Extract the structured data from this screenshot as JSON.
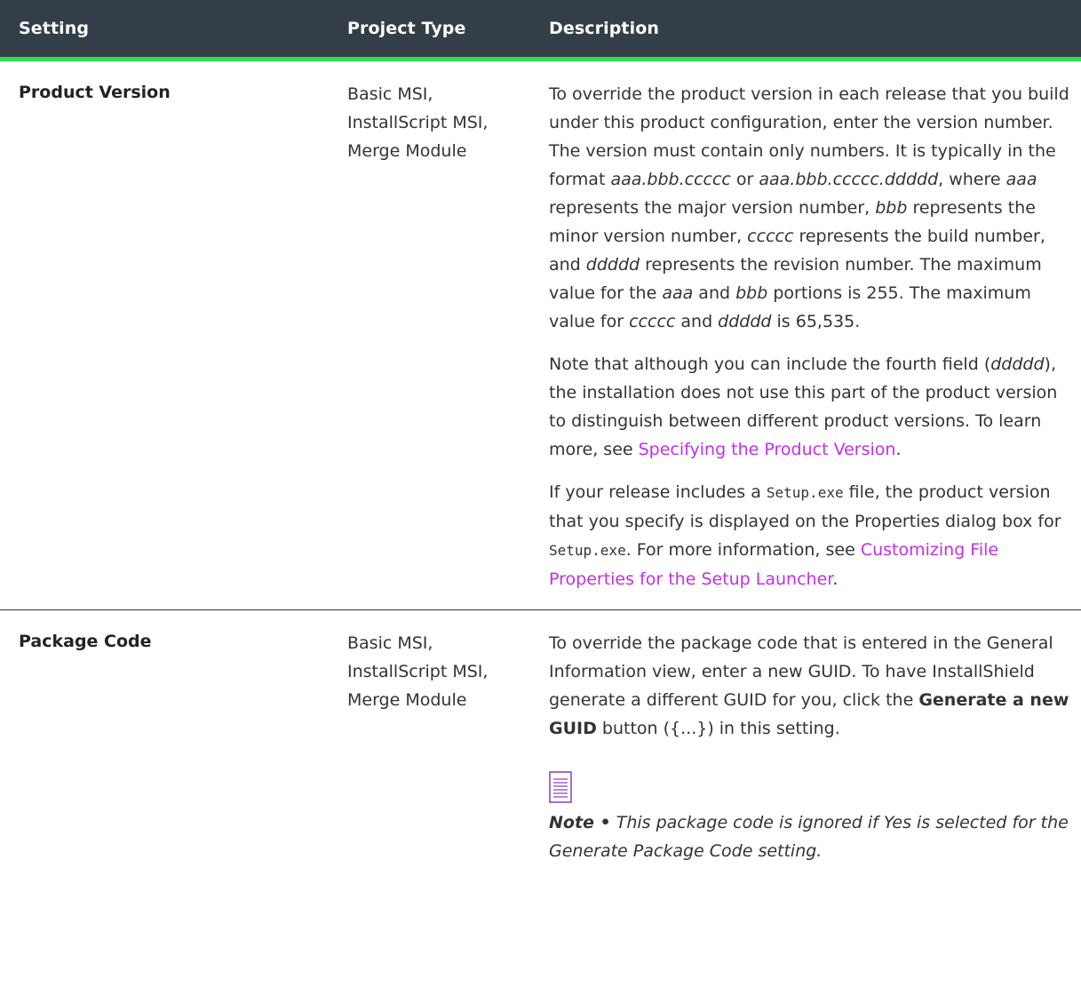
{
  "header": {
    "setting": "Setting",
    "project_type": "Project Type",
    "description": "Description"
  },
  "rows": [
    {
      "setting": "Product Version",
      "project_type": [
        "Basic MSI,",
        "InstallScript MSI,",
        "Merge Module"
      ],
      "p1": {
        "t1": "To override the product version in each release that you build under this product configuration, enter the version number. The version must contain only numbers. It is typically in the format ",
        "i1": "aaa.bbb.ccccc",
        "t2": " or ",
        "i2": "aaa.bbb.ccccc.ddddd",
        "t3": ", where ",
        "i3": "aaa",
        "t4": " represents the major version number, ",
        "i4": "bbb",
        "t5": " represents the minor version number, ",
        "i5": "ccccc",
        "t6": " represents the build number, and ",
        "i6": "ddddd",
        "t7": " represents the revision number. The maximum value for the ",
        "i7": "aaa",
        "t8": " and ",
        "i8": "bbb",
        "t9": " portions is 255. The maximum value for ",
        "i9": "ccccc",
        "t10": " and ",
        "i10": "ddddd",
        "t11": " is 65,535."
      },
      "p2": {
        "t1": "Note that although you can include the fourth field (",
        "i1": "ddddd",
        "t2": "), the installation does not use this part of the product version to distinguish between different product versions. To learn more, see ",
        "link": "Specifying the Product Version",
        "t3": "."
      },
      "p3": {
        "t1": "If your release includes a ",
        "code1": "Setup.exe",
        "t2": " file, the product version that you specify is displayed on the Properties dialog box for ",
        "code2": "Setup.exe",
        "t3": ". For more information, see ",
        "link": "Customizing File Properties for the Setup Launcher",
        "t4": "."
      }
    },
    {
      "setting": "Package Code",
      "project_type": [
        "Basic MSI,",
        "InstallScript MSI,",
        "Merge Module"
      ],
      "p1": {
        "t1": "To override the package code that is entered in the General Information view, enter a new GUID. To have InstallShield generate a different GUID for you, click the ",
        "b1": "Generate a new GUID",
        "t2": " button ({...}) in this setting."
      },
      "note": {
        "icon": "note-icon",
        "label": "Note •",
        "text": " This package code is ignored if Yes is selected for the Generate Package Code setting."
      }
    }
  ],
  "colors": {
    "header_bg": "#333e48",
    "header_accent": "#2fdd53",
    "link": "#c230e6",
    "icon": "#8a3ab9"
  }
}
